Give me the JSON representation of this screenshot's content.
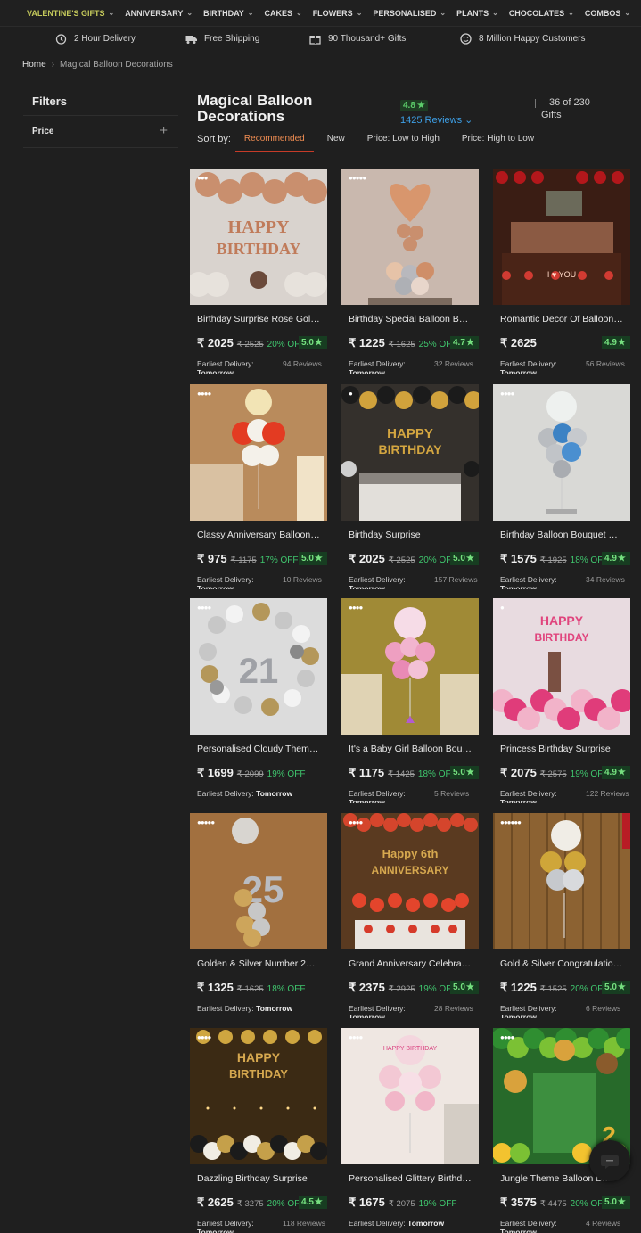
{
  "nav": [
    {
      "label": "VALENTINE'S GIFTS",
      "active": true
    },
    {
      "label": "ANNIVERSARY"
    },
    {
      "label": "BIRTHDAY"
    },
    {
      "label": "CAKES"
    },
    {
      "label": "FLOWERS"
    },
    {
      "label": "PERSONALISED"
    },
    {
      "label": "PLANTS"
    },
    {
      "label": "CHOCOLATES"
    },
    {
      "label": "COMBOS"
    }
  ],
  "benefits": [
    {
      "icon": "alarm-clock-icon",
      "label": "2 Hour Delivery"
    },
    {
      "icon": "truck-icon",
      "label": "Free Shipping"
    },
    {
      "icon": "gift-box-icon",
      "label": "90 Thousand+ Gifts"
    },
    {
      "icon": "smiley-icon",
      "label": "8 Million Happy Customers"
    }
  ],
  "breadcrumb": {
    "home": "Home",
    "current": "Magical Balloon Decorations"
  },
  "filters": {
    "title": "Filters",
    "price_label": "Price"
  },
  "header": {
    "title": "Magical Balloon Decorations",
    "rating": "4.8",
    "reviews": "1425 Reviews",
    "count": "36 of 230",
    "count_unit": "Gifts"
  },
  "sort": {
    "label": "Sort by:",
    "options": [
      "Recommended",
      "New",
      "Price: Low to High",
      "Price: High to Low"
    ]
  },
  "delivery_label": "Earliest Delivery:",
  "delivery_value": "Tomorrow",
  "products": [
    {
      "name": "Birthday Surprise Rose Gold ...",
      "price": "₹ 2025",
      "mrp": "₹ 2525",
      "off": "20% OFF",
      "rating": "5.0",
      "reviews": "94 Reviews",
      "dots": "●●●",
      "scene": "rosegold"
    },
    {
      "name": "Birthday Special Balloon Bo...",
      "price": "₹ 1225",
      "mrp": "₹ 1625",
      "off": "25% OFF",
      "rating": "4.7",
      "reviews": "32 Reviews",
      "dots": "●●●●●",
      "scene": "heart"
    },
    {
      "name": "Romantic Decor Of Balloons...",
      "price": "₹ 2625",
      "mrp": "",
      "off": "",
      "rating": "4.9",
      "reviews": "56 Reviews",
      "dots": "",
      "scene": "romantic"
    },
    {
      "name": "Classy Anniversary Balloon ...",
      "price": "₹ 975",
      "mrp": "₹ 1175",
      "off": "17% OFF",
      "rating": "5.0",
      "reviews": "10 Reviews",
      "dots": "●●●●",
      "scene": "classy"
    },
    {
      "name": "Birthday Surprise",
      "price": "₹ 2025",
      "mrp": "₹ 2525",
      "off": "20% OFF",
      "rating": "5.0",
      "reviews": "157 Reviews",
      "dots": "●",
      "scene": "goldbday"
    },
    {
      "name": "Birthday Balloon Bouquet Fo...",
      "price": "₹ 1575",
      "mrp": "₹ 1925",
      "off": "18% OFF",
      "rating": "4.9",
      "reviews": "34 Reviews",
      "dots": "●●●●",
      "scene": "bouquet"
    },
    {
      "name": "Personalised Cloudy Theme ...",
      "price": "₹ 1699",
      "mrp": "₹ 2099",
      "off": "19% OFF",
      "rating": "",
      "reviews": "",
      "dots": "●●●●",
      "scene": "cloudy"
    },
    {
      "name": "It's a Baby Girl Balloon Bouq...",
      "price": "₹ 1175",
      "mrp": "₹ 1425",
      "off": "18% OFF",
      "rating": "5.0",
      "reviews": "5 Reviews",
      "dots": "●●●●",
      "scene": "babygirl"
    },
    {
      "name": "Princess Birthday Surprise",
      "price": "₹ 2075",
      "mrp": "₹ 2575",
      "off": "19% OFF",
      "rating": "4.9",
      "reviews": "122 Reviews",
      "dots": "●",
      "scene": "princess"
    },
    {
      "name": "Golden & Silver Number 25 ...",
      "price": "₹ 1325",
      "mrp": "₹ 1625",
      "off": "18% OFF",
      "rating": "",
      "reviews": "",
      "dots": "●●●●●",
      "scene": "num25"
    },
    {
      "name": "Grand Anniversary Celebrati...",
      "price": "₹ 2375",
      "mrp": "₹ 2925",
      "off": "19% OFF",
      "rating": "5.0",
      "reviews": "28 Reviews",
      "dots": "●●●●",
      "scene": "grand"
    },
    {
      "name": "Gold & Silver Congratulation...",
      "price": "₹ 1225",
      "mrp": "₹ 1525",
      "off": "20% OFF",
      "rating": "5.0",
      "reviews": "6 Reviews",
      "dots": "●●●●●●",
      "scene": "congrats"
    },
    {
      "name": "Dazzling Birthday Surprise",
      "price": "₹ 2625",
      "mrp": "₹ 3275",
      "off": "20% OFF",
      "rating": "4.5",
      "reviews": "118 Reviews",
      "dots": "●●●●",
      "scene": "dazzling"
    },
    {
      "name": "Personalised Glittery Birthda...",
      "price": "₹ 1675",
      "mrp": "₹ 2075",
      "off": "19% OFF",
      "rating": "",
      "reviews": "",
      "dots": "●●●●",
      "scene": "glittery"
    },
    {
      "name": "Jungle Theme Balloon D...",
      "price": "₹ 3575",
      "mrp": "₹ 4475",
      "off": "20% OFF",
      "rating": "5.0",
      "reviews": "4 Reviews",
      "dots": "●●●●",
      "scene": "jungle"
    }
  ],
  "colors": {
    "accent": "#f08d52",
    "rating_green": "#75e07f",
    "link": "#3d9fe6"
  }
}
